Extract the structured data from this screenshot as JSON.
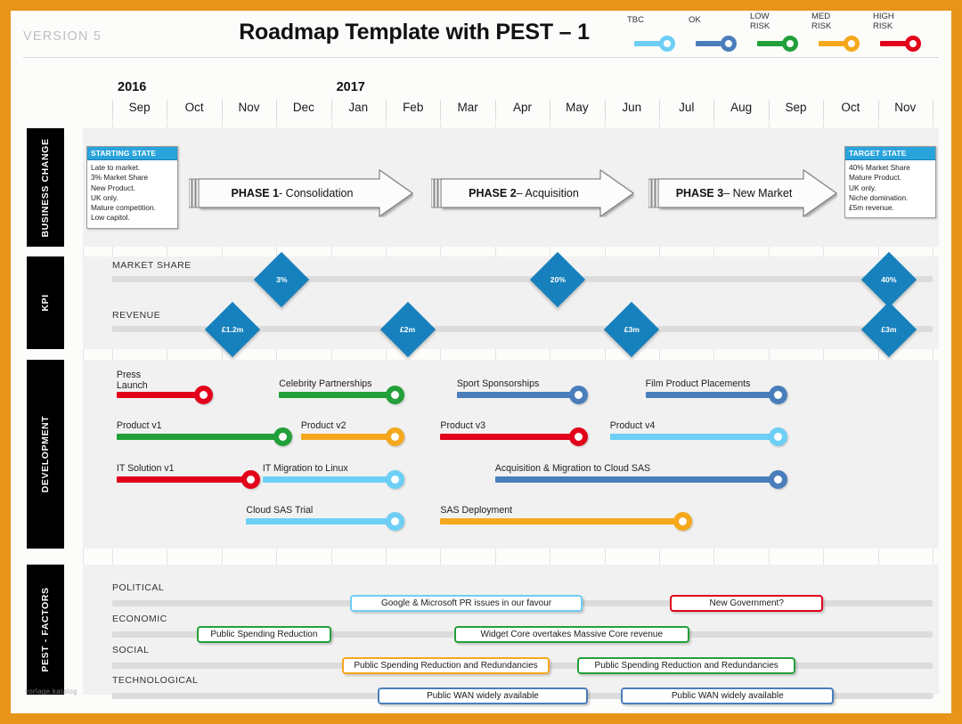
{
  "header": {
    "version": "VERSION 5",
    "title": "Roadmap Template with PEST – 1",
    "watermark": "vorlage katalog"
  },
  "legend": {
    "items": [
      {
        "label": "TBC",
        "color": "#6DCFF6"
      },
      {
        "label": "OK",
        "color": "#4A7EBB"
      },
      {
        "label": "LOW\nRISK",
        "line1": "LOW",
        "line2": "RISK",
        "color": "#22A039"
      },
      {
        "label": "MED\nRISK",
        "line1": "MED",
        "line2": "RISK",
        "color": "#F5A81C"
      },
      {
        "label": "HIGH\nRISK",
        "line1": "HIGH",
        "line2": "RISK",
        "color": "#E2001A"
      }
    ]
  },
  "timeline": {
    "years": [
      {
        "label": "2016",
        "month_index": 0
      },
      {
        "label": "2017",
        "month_index": 4
      }
    ],
    "months": [
      "Sep",
      "Oct",
      "Nov",
      "Dec",
      "Jan",
      "Feb",
      "Mar",
      "Apr",
      "May",
      "Jun",
      "Jul",
      "Aug",
      "Sep",
      "Oct",
      "Nov"
    ]
  },
  "bands": {
    "business_change": {
      "label": "BUSINESS CHANGE",
      "starting_state": {
        "title": "STARTING STATE",
        "lines": [
          "Late to market.",
          "3% Market Share",
          "New Product.",
          "UK only.",
          "Mature competition.",
          "Low capitol."
        ]
      },
      "target_state": {
        "title": "TARGET STATE",
        "lines": [
          "40% Market Share",
          "Mature Product.",
          "UK only.",
          "Niche domination.",
          "£5m revenue."
        ]
      },
      "phases": [
        {
          "bold": "PHASE 1",
          "rest": " - Consolidation"
        },
        {
          "bold": "PHASE 2",
          "rest": " – Acquisition"
        },
        {
          "bold": "PHASE 3",
          "rest": " – New Market"
        }
      ]
    },
    "kpi": {
      "label": "KPI",
      "rows": [
        {
          "title": "MARKET SHARE",
          "markers": [
            {
              "value": "3%",
              "month": 3.1
            },
            {
              "value": "20%",
              "month": 8.15
            },
            {
              "value": "40%",
              "month": 14.2
            }
          ]
        },
        {
          "title": "REVENUE",
          "markers": [
            {
              "value": "£1.2m",
              "month": 2.2
            },
            {
              "value": "£2m",
              "month": 5.4
            },
            {
              "value": "£3m",
              "month": 9.5
            },
            {
              "value": "£3m",
              "month": 14.2
            }
          ]
        }
      ]
    },
    "development": {
      "label": "DEVELOPMENT",
      "rows": [
        [
          {
            "label": "Press\nLaunch",
            "l1": "Press",
            "l2": "Launch",
            "color": "#E2001A",
            "start": 0.08,
            "end": 1.75,
            "two_line": true
          },
          {
            "label": "Celebrity Partnerships",
            "color": "#22A039",
            "start": 3.05,
            "end": 5.25
          },
          {
            "label": "Sport Sponsorships",
            "color": "#4A7EBB",
            "start": 6.3,
            "end": 8.6
          },
          {
            "label": "Film Product Placements",
            "color": "#4A7EBB",
            "start": 9.75,
            "end": 12.25
          }
        ],
        [
          {
            "label": "Product v1",
            "color": "#22A039",
            "start": 0.08,
            "end": 3.2
          },
          {
            "label": "Product v2",
            "color": "#F5A81C",
            "start": 3.45,
            "end": 5.25
          },
          {
            "label": "Product  v3",
            "color": "#E2001A",
            "start": 6.0,
            "end": 8.6
          },
          {
            "label": "Product  v4",
            "color": "#6DCFF6",
            "start": 9.1,
            "end": 12.25
          }
        ],
        [
          {
            "label": "IT Solution v1",
            "color": "#E2001A",
            "start": 0.08,
            "end": 2.6
          },
          {
            "label": "IT Migration to Linux",
            "color": "#6DCFF6",
            "start": 2.75,
            "end": 5.25
          },
          {
            "label": "Acquisition & Migration to Cloud SAS",
            "color": "#4A7EBB",
            "start": 7.0,
            "end": 12.25
          }
        ],
        [
          {
            "label": "Cloud SAS Trial",
            "color": "#6DCFF6",
            "start": 2.45,
            "end": 5.25
          },
          {
            "label": "SAS Deployment",
            "color": "#F5A81C",
            "start": 6.0,
            "end": 10.5
          }
        ]
      ]
    },
    "pest": {
      "label": "PEST - FACTORS",
      "rows": [
        {
          "title": "POLITICAL",
          "pills": [
            {
              "text": "Google & Microsoft PR issues in our favour",
              "color": "#6DCFF6",
              "start": 4.35,
              "end": 8.6
            },
            {
              "text": "New Government?",
              "color": "#E2001A",
              "start": 10.2,
              "end": 13.0
            }
          ]
        },
        {
          "title": "ECONOMIC",
          "pills": [
            {
              "text": "Public Spending Reduction",
              "color": "#22A039",
              "start": 1.55,
              "end": 4.0
            },
            {
              "text": "Widget Core overtakes Massive Core revenue",
              "color": "#22A039",
              "start": 6.25,
              "end": 10.55
            }
          ]
        },
        {
          "title": "SOCIAL",
          "pills": [
            {
              "text": "Public Spending Reduction and Redundancies",
              "color": "#F5A81C",
              "start": 4.2,
              "end": 8.0
            },
            {
              "text": "Public Spending Reduction and Redundancies",
              "color": "#22A039",
              "start": 8.5,
              "end": 12.5
            }
          ]
        },
        {
          "title": "TECHNOLOGICAL",
          "pills": [
            {
              "text": "Public WAN widely available",
              "color": "#4A7EBB",
              "start": 4.85,
              "end": 8.7
            },
            {
              "text": "Public WAN widely available",
              "color": "#4A7EBB",
              "start": 9.3,
              "end": 13.2
            }
          ]
        }
      ]
    }
  },
  "colors": {
    "frame": "#E8941A",
    "band_label_bg": "#000000",
    "track": "#DCDCDC",
    "diamond": "#1781BD",
    "state_header": "#29A3DC"
  }
}
